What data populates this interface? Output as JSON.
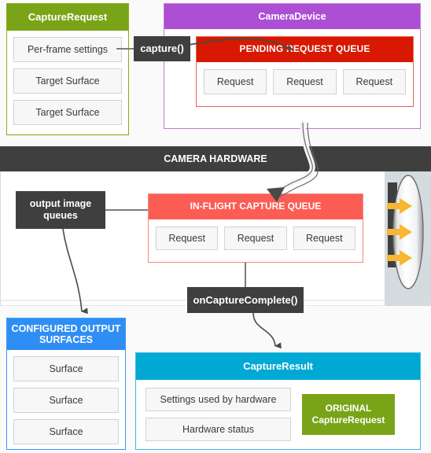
{
  "capture_request": {
    "title": "CaptureRequest",
    "header_color": "#79a417",
    "items": [
      "Per-frame settings",
      "Target Surface",
      "Target Surface"
    ]
  },
  "capture_call": {
    "label": "capture()"
  },
  "camera_device": {
    "title": "CameraDevice",
    "header_color": "#ac4fd4",
    "pending_queue": {
      "title": "PENDING REQUEST QUEUE",
      "header_color": "#d81800",
      "items": [
        "Request",
        "Request",
        "Request"
      ]
    }
  },
  "camera_hardware": {
    "title": "CAMERA HARDWARE",
    "header_color": "#403f3f",
    "inflight_queue": {
      "title": "IN-FLIGHT CAPTURE QUEUE",
      "header_color": "#fb5d55",
      "items": [
        "Request",
        "Request",
        "Request"
      ]
    },
    "output_queues": {
      "label": "output image queues"
    },
    "sensor": {
      "lens_label": "lens",
      "arrow_count": 3,
      "arrow_color": "#f7b733"
    }
  },
  "on_capture_complete": {
    "label": "onCaptureComplete()"
  },
  "configured_output_surfaces": {
    "title": "CONFIGURED OUTPUT SURFACES",
    "header_color": "#2f8ef4",
    "items": [
      "Surface",
      "Surface",
      "Surface"
    ]
  },
  "capture_result": {
    "title": "CaptureResult",
    "header_color": "#00a9d4",
    "items": [
      "Settings used by hardware",
      "Hardware status"
    ],
    "original_request": {
      "label": "ORIGINAL\nCaptureRequest",
      "color": "#79a417"
    }
  }
}
